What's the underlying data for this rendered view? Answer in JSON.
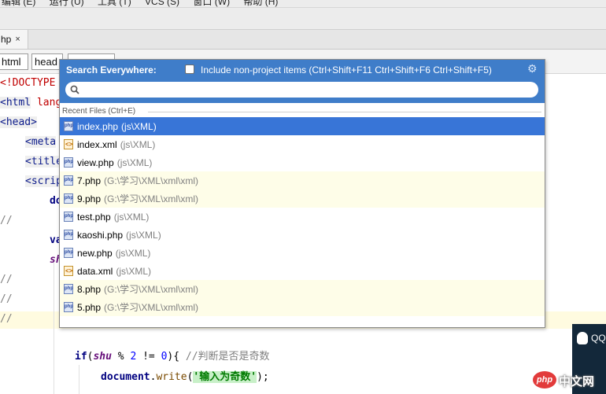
{
  "menu": [
    "编辑 (E)",
    "运行 (U)",
    "工具 (T)",
    "VCS (S)",
    "窗口 (W)",
    "帮助 (H)"
  ],
  "file_tab": {
    "label": "hp",
    "close": "×"
  },
  "breadcrumb": [
    "html",
    "head"
  ],
  "editor": {
    "lines": {
      "l0": "<!DOCTYPE",
      "l1_tag": "<html",
      "l1_attr": " lang",
      "l2": "<head>",
      "l3": "<meta",
      "l4": "<title",
      "l5": "<scrip",
      "l6": "do",
      "l7": "//",
      "l8": "va",
      "l9": "sh",
      "l10": "//",
      "l11": "//",
      "l12": "//",
      "l13_if": "if",
      "l13_var": "shu",
      "l13_rest": " % ",
      "l13_num1": "2",
      "l13_rest2": " != ",
      "l13_num2": "0",
      "l13_rest3": "){ ",
      "l13_comment": "//判断是否是奇数",
      "l14_obj": "document",
      "l14_dot": ".",
      "l14_fn": "write",
      "l14_open": "(",
      "l14_str": "'输入为奇数'",
      "l14_close": ");"
    }
  },
  "search_popup": {
    "title": "Search Everywhere:",
    "include_label": "Include non-project items (Ctrl+Shift+F11 Ctrl+Shift+F6 Ctrl+Shift+F5)",
    "include_checked": false,
    "query": "",
    "section_label": "Recent Files (Ctrl+E)",
    "files": [
      {
        "name": "index.php",
        "path": "(js\\XML)",
        "type": "php",
        "selected": true,
        "outside": false
      },
      {
        "name": "index.xml",
        "path": "(js\\XML)",
        "type": "xml",
        "selected": false,
        "outside": false
      },
      {
        "name": "view.php",
        "path": "(js\\XML)",
        "type": "php",
        "selected": false,
        "outside": false
      },
      {
        "name": "7.php",
        "path": "(G:\\学习\\XML\\xml\\xml)",
        "type": "php",
        "selected": false,
        "outside": true
      },
      {
        "name": "9.php",
        "path": "(G:\\学习\\XML\\xml\\xml)",
        "type": "php",
        "selected": false,
        "outside": true
      },
      {
        "name": "test.php",
        "path": "(js\\XML)",
        "type": "php",
        "selected": false,
        "outside": false
      },
      {
        "name": "kaoshi.php",
        "path": "(js\\XML)",
        "type": "php",
        "selected": false,
        "outside": false
      },
      {
        "name": "new.php",
        "path": "(js\\XML)",
        "type": "php",
        "selected": false,
        "outside": false
      },
      {
        "name": "data.xml",
        "path": "(js\\XML)",
        "type": "xml",
        "selected": false,
        "outside": false
      },
      {
        "name": "8.php",
        "path": "(G:\\学习\\XML\\xml\\xml)",
        "type": "php",
        "selected": false,
        "outside": true
      },
      {
        "name": "5.php",
        "path": "(G:\\学习\\XML\\xml\\xml)",
        "type": "php",
        "selected": false,
        "outside": true
      }
    ]
  },
  "qq_widget": {
    "label": "QQ"
  },
  "watermark": {
    "badge": "php",
    "text": "中文网"
  },
  "colors": {
    "popup_header": "#3f7dc9",
    "selection": "#3875d7",
    "outside_row": "#fefde8"
  }
}
